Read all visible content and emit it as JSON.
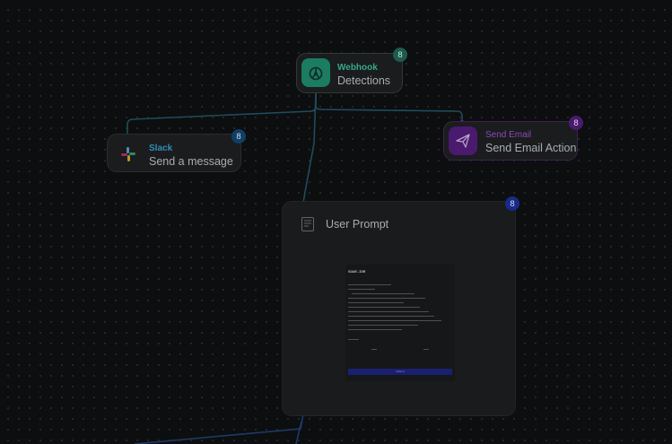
{
  "colors": {
    "canvas": "#0d0e0f",
    "edge": "#1f4c5c",
    "webhook_accent": "#1b7c62",
    "email_accent": "#4a1a6e",
    "slack_badge": "#0f3f66",
    "prompt_badge": "#1a2a8a"
  },
  "nodes": {
    "webhook": {
      "type": "Webhook",
      "label": "Detections",
      "badge": "8",
      "icon": "webhook-icon"
    },
    "slack": {
      "type": "Slack",
      "label": "Send a message",
      "badge": "8",
      "icon": "slack-icon"
    },
    "email": {
      "type": "Send Email",
      "label": "Send Email Action",
      "badge": "8",
      "icon": "paper-plane-icon"
    },
    "prompt": {
      "label": "User Prompt",
      "badge": "8",
      "icon": "prompt-icon",
      "preview": {
        "title": "SOAR-IDR",
        "submit_label": "Submit"
      }
    }
  }
}
